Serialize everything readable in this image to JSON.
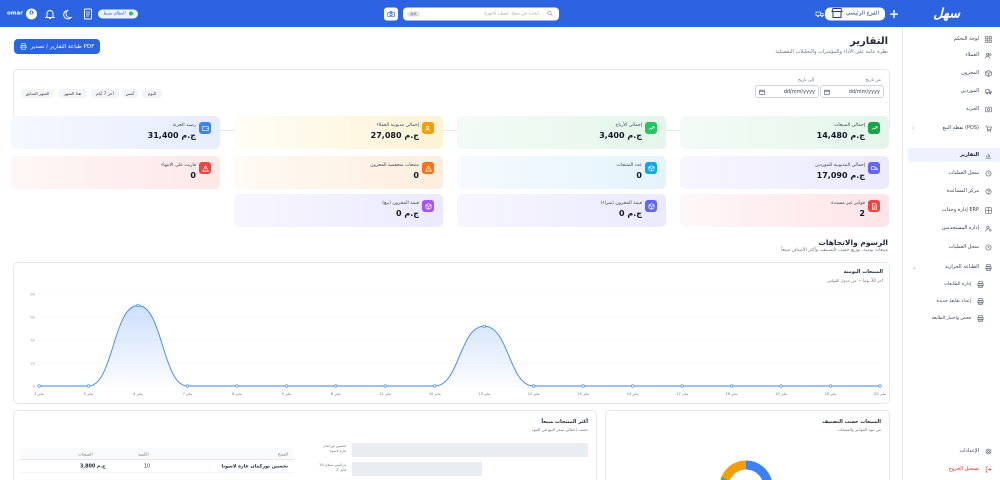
{
  "topbar": {
    "logo": "سهل",
    "branch": "الفرع الرئيسي",
    "search_placeholder": "ابحث عن منتج، عميل، فاتورة...",
    "search_shortcut": "⌘K",
    "online_status": "النظام نشط",
    "user_name": "omar",
    "user_initial": "O"
  },
  "sidebar": {
    "items": [
      {
        "label": "لوحة التحكم",
        "icon": "dashboard-icon"
      },
      {
        "label": "العملاء",
        "icon": "users-icon"
      },
      {
        "label": "المخزون",
        "icon": "box-icon"
      },
      {
        "label": "الموردين",
        "icon": "truck-icon"
      },
      {
        "label": "الخزنة",
        "icon": "safe-icon"
      },
      {
        "label": "نقطة البيع (POS)",
        "icon": "cart-icon"
      },
      {
        "label": "التقارير",
        "icon": "chart-icon"
      },
      {
        "label": "سجل العمليات",
        "icon": "history-icon"
      },
      {
        "label": "مركز المساعدة",
        "icon": "help-icon"
      },
      {
        "label": "إدارة وحدات ERP",
        "icon": "grid-icon"
      },
      {
        "label": "إدارة المستخدمين",
        "icon": "user-cog-icon"
      },
      {
        "label": "سجل العمليات",
        "icon": "log-icon"
      },
      {
        "label": "الطباعة الحرارية",
        "icon": "printer-icon"
      }
    ],
    "sub_items": [
      {
        "label": "إدارة الطابعات",
        "icon": "printer-icon"
      },
      {
        "label": "إعداد طابعة جديدة",
        "icon": "printer-icon"
      },
      {
        "label": "فحص واختبار الطابعة",
        "icon": "printer-icon"
      }
    ],
    "settings": "الإعدادات",
    "logout": "تسجيل الخروج"
  },
  "header": {
    "title": "التقارير",
    "subtitle": "نظرة عامة على الأداء والمؤشرات والتحليلات التفصيلية",
    "print_button": "طباعة التقارير / تصدير PDF"
  },
  "filters": {
    "from_label": "من تاريخ",
    "to_label": "إلى تاريخ",
    "from_value": "dd/mm/yyyy",
    "to_value": "dd/mm/yyyy",
    "quick": [
      "اليوم",
      "أمس",
      "آخر 7 أيام",
      "هذا الشهر",
      "الشهر السابق"
    ]
  },
  "cards": [
    {
      "title": "إجمالي المبيعات",
      "value": "14,480 ج.م",
      "icon": "trend-up-icon",
      "color": "#16a34a"
    },
    {
      "title": "إجمالي الأرباح",
      "value": "3,400 ج.م",
      "icon": "trend-up-icon",
      "color": "#22c55e"
    },
    {
      "title": "إجمالي مديونية العملاء",
      "value": "27,080 ج.م",
      "icon": "users-icon",
      "color": "#f59e0b"
    },
    {
      "title": "رصيد الخزنة",
      "value": "31,400 ج.م",
      "icon": "wallet-icon",
      "color": "#3b82f6"
    },
    {
      "title": "إجمالي المديونية للموردين",
      "value": "17,090 ج.م",
      "icon": "truck-icon",
      "color": "#6366f1"
    },
    {
      "title": "عدد المنتجات",
      "value": "0",
      "icon": "cube-icon",
      "color": "#0ea5e9"
    },
    {
      "title": "منتجات منخفضة المخزون",
      "value": "0",
      "icon": "alert-icon",
      "color": "#f97316"
    },
    {
      "title": "قاربت على الانتهاء",
      "value": "0",
      "icon": "alert-icon",
      "color": "#ef4444"
    },
    {
      "title": "فواتير غير مسددة",
      "value": "2",
      "icon": "file-icon",
      "color": "#ef4444"
    },
    {
      "title": "قيمة المخزون (شراء)",
      "value": "0 ج.م",
      "icon": "cube-icon",
      "color": "#6366f1"
    },
    {
      "title": "قيمة المخزون (بيع)",
      "value": "0 ج.م",
      "icon": "cube-icon",
      "color": "#a855f7"
    }
  ],
  "charts_section": {
    "title": "الرسوم والاتجاهات",
    "subtitle": "مبيعات يومية، توزيع حسب التصنيف، وأكثر الأصناف مبيعاً"
  },
  "daily_chart": {
    "title": "المبيعات اليومية",
    "subtitle": "آخر 30 يوماً — من جدول الفواتير"
  },
  "chart_data": {
    "type": "area",
    "x": [
      "يناير 3",
      "يناير 5",
      "يناير 4",
      "يناير 7",
      "يناير 6",
      "يناير 9",
      "يناير 8",
      "يناير 11",
      "يناير 10",
      "يناير 13",
      "يناير 12",
      "يناير 15",
      "يناير 14",
      "يناير 17",
      "يناير 16",
      "يناير 19",
      "يناير 18",
      "يناير 20"
    ],
    "y_ticks": [
      "0",
      "2k",
      "4k",
      "6k",
      "8k"
    ],
    "series": [
      {
        "values": [
          0,
          0,
          7000,
          0,
          0,
          0,
          0,
          0,
          0,
          5200,
          0,
          0,
          0,
          0,
          0,
          0,
          0,
          0
        ]
      }
    ],
    "ylim": [
      0,
      8000
    ],
    "color": "#3b82f6"
  },
  "top_products": {
    "title": "أكثر المنتجات مبيعاً",
    "subtitle": "حسب إجمالي سعر البيع في البنود",
    "headers": [
      "المنتج",
      "الكمية",
      "المبيعات"
    ],
    "rows": [
      {
        "product": "تحسين توركمان غارة لاسونا",
        "qty": "10",
        "sales": "3,800 ج.م"
      }
    ],
    "bar_labels": [
      "تحسين توركمان غارة لاسونا",
      "بنزاليس سيلان 15 قابل 5"
    ]
  },
  "category_sales": {
    "title": "المبيعات حسب التصنيف",
    "subtitle": "من بنود الفواتير والمنتجات"
  }
}
